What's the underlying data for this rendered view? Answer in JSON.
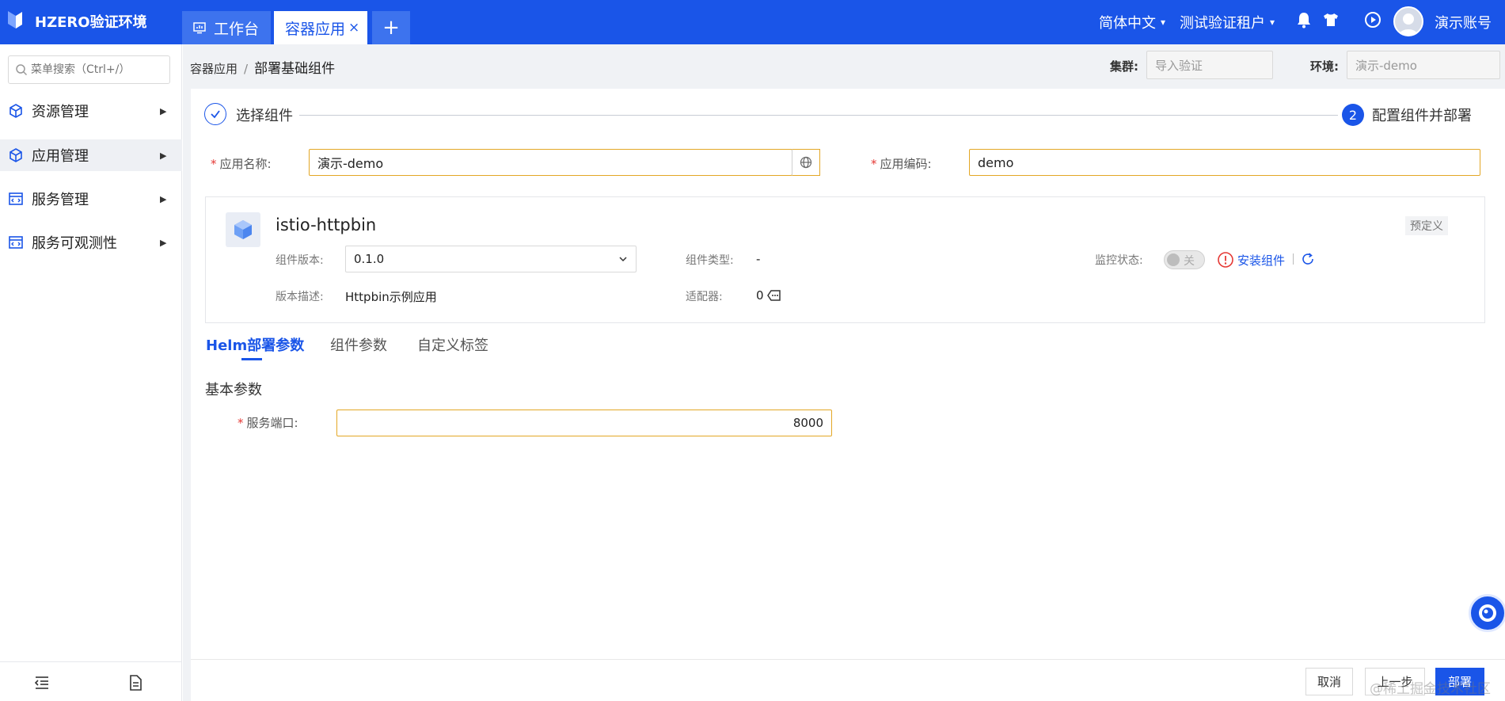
{
  "app": {
    "title": "HZERO验证环境"
  },
  "tabs": [
    {
      "label": "工作台",
      "icon": "monitor-icon"
    },
    {
      "label": "容器应用",
      "close": "×"
    },
    {
      "label": "+"
    }
  ],
  "header": {
    "language": "简体中文",
    "tenant": "测试验证租户",
    "username": "演示账号",
    "colors": {
      "primary": "#1a55e8",
      "required": "#e53935",
      "warning": "#e3a725"
    }
  },
  "sidebar": {
    "search_placeholder": "菜单搜索（Ctrl+/）",
    "items": [
      {
        "label": "资源管理",
        "icon": "cube-icon"
      },
      {
        "label": "应用管理",
        "icon": "cube-icon",
        "active": true
      },
      {
        "label": "服务管理",
        "icon": "code-window-icon"
      },
      {
        "label": "服务可观测性",
        "icon": "code-window-icon"
      }
    ]
  },
  "breadcrumb": {
    "parent": "容器应用",
    "separator": "/",
    "current": "部署基础组件"
  },
  "filters": {
    "cluster_label": "集群:",
    "cluster_value": "导入验证",
    "env_label": "环境:",
    "env_value": "演示-demo"
  },
  "steps": [
    {
      "label": "选择组件",
      "state": "done"
    },
    {
      "number": "2",
      "label": "配置组件并部署",
      "state": "current"
    }
  ],
  "form": {
    "app_name_label": "应用名称:",
    "app_name_value": "演示-demo",
    "app_code_label": "应用编码:",
    "app_code_value": "demo"
  },
  "component": {
    "name": "istio-httpbin",
    "tag": "预定义",
    "version_label": "组件版本:",
    "version_value": "0.1.0",
    "type_label": "组件类型:",
    "type_value": "-",
    "monitor_label": "监控状态:",
    "monitor_toggle": "关",
    "install_link": "安装组件",
    "desc_label": "版本描述:",
    "desc_value": "Httpbin示例应用",
    "adapter_label": "适配器:",
    "adapter_value": "0"
  },
  "detail_tabs": [
    "Helm部署参数",
    "组件参数",
    "自定义标签"
  ],
  "basic_params": {
    "title": "基本参数",
    "port_label": "服务端口:",
    "port_value": "8000"
  },
  "footer": {
    "cancel": "取消",
    "prev": "上一步",
    "deploy": "部署",
    "watermark": "@稀土掘金技术社区"
  }
}
